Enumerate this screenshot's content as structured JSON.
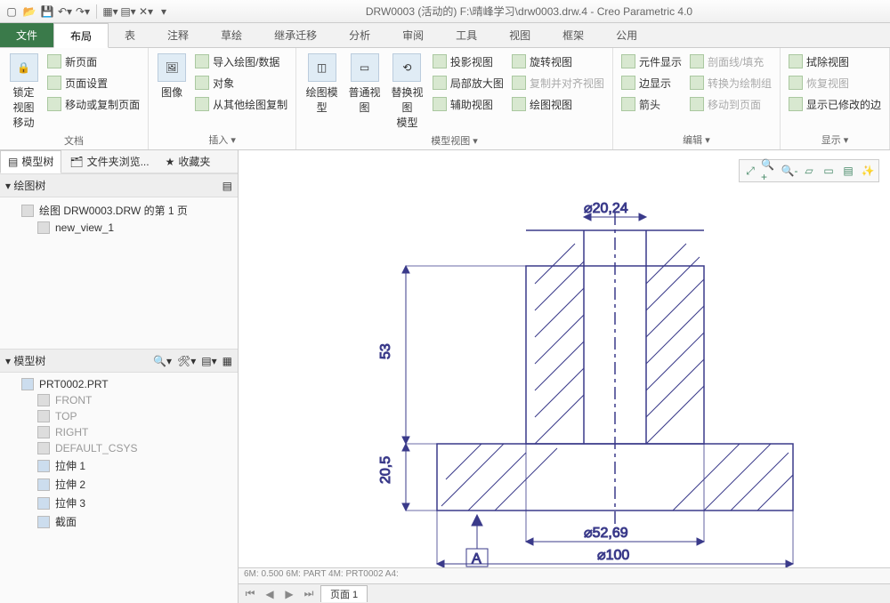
{
  "title": "DRW0003 (活动的) F:\\晴峰学习\\drw0003.drw.4 - Creo Parametric 4.0",
  "tabs": {
    "file": "文件",
    "list": [
      "布局",
      "表",
      "注释",
      "草绘",
      "继承迁移",
      "分析",
      "审阅",
      "工具",
      "视图",
      "框架",
      "公用"
    ],
    "active": 0
  },
  "ribbon": {
    "g1": {
      "big": "锁定视图\n移动",
      "items": [
        "新页面",
        "页面设置",
        "移动或复制页面"
      ],
      "label": "文档"
    },
    "g2": {
      "big": "图像",
      "items": [
        "导入绘图/数据",
        "对象",
        "从其他绘图复制"
      ],
      "label": "插入 ▾"
    },
    "g3": {
      "bigs": [
        "绘图模型",
        "普通视图",
        "替换视图\n模型"
      ],
      "cols": [
        [
          "投影视图",
          "局部放大图",
          "辅助视图"
        ],
        [
          "旋转视图",
          "复制并对齐视图",
          "绘图视图"
        ]
      ],
      "label": "模型视图 ▾"
    },
    "g4": {
      "cols": [
        [
          "元件显示",
          "边显示",
          "箭头"
        ],
        [
          "剖面线/填充",
          "转换为绘制组",
          "移动到页面"
        ]
      ],
      "label": "编辑 ▾"
    },
    "g5": {
      "items": [
        "拭除视图",
        "恢复视图",
        "显示已修改的边"
      ],
      "label": "显示 ▾"
    }
  },
  "leftTabs": [
    "模型树",
    "文件夹浏览...",
    "收藏夹"
  ],
  "drawTree": {
    "head": "绘图树",
    "root": "绘图 DRW0003.DRW 的第 1 页",
    "child": "new_view_1"
  },
  "modelTree": {
    "head": "模型树",
    "root": "PRT0002.PRT",
    "items": [
      "FRONT",
      "TOP",
      "RIGHT",
      "DEFAULT_CSYS",
      "拉伸 1",
      "拉伸 2",
      "拉伸 3",
      "截面"
    ]
  },
  "dims": {
    "d1": "⌀20,24",
    "d2": "53",
    "d3": "20,5",
    "d4": "⌀52,69",
    "d5": "⌀100",
    "datum": "A"
  },
  "footer": "6M: 0.500   6M: PART   4M: PRT0002   A4:",
  "sheet": "页面 1"
}
